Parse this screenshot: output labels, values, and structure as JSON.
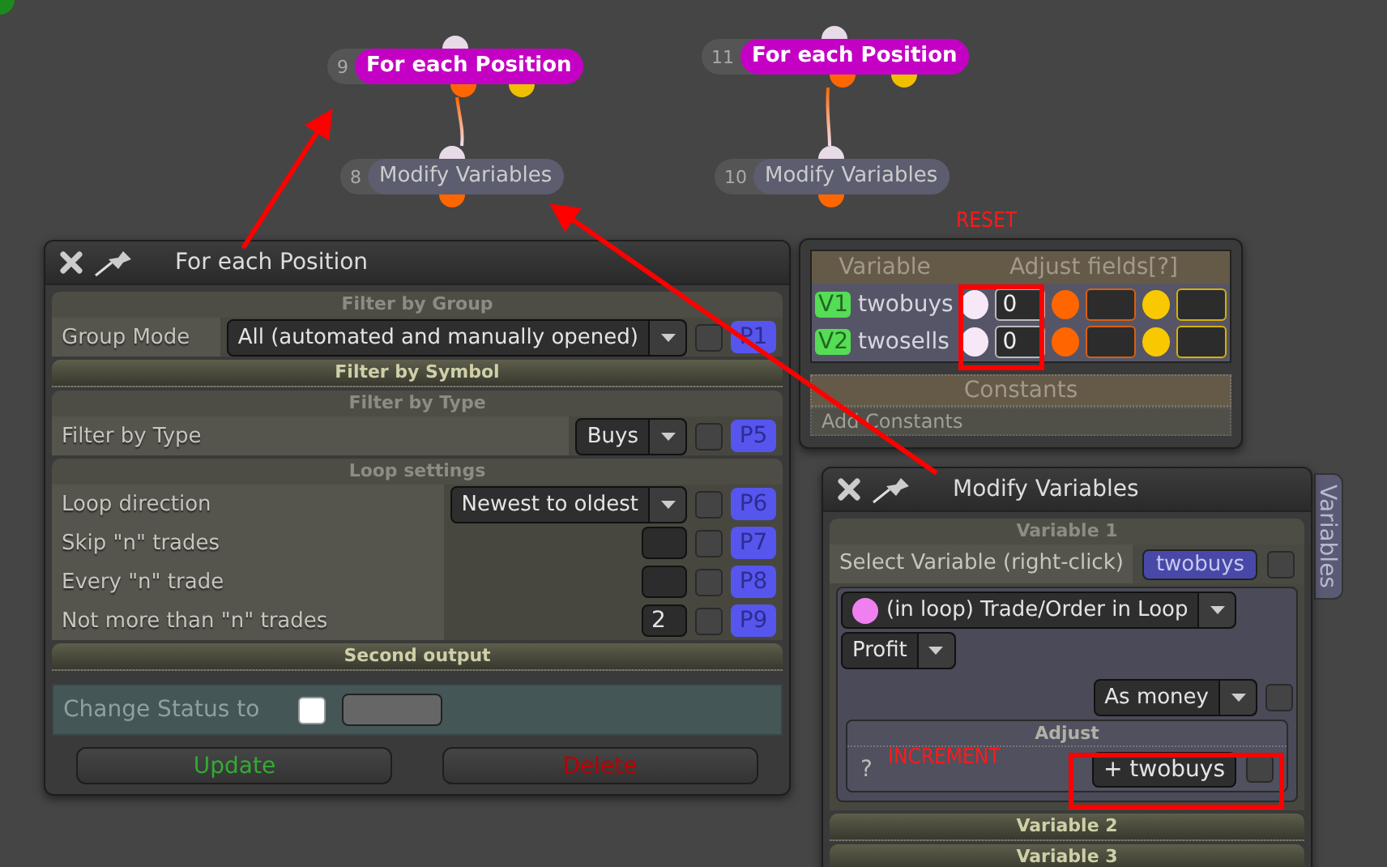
{
  "canvas_nodes": [
    {
      "number": "9",
      "label": "For each Position",
      "kind": "loop"
    },
    {
      "number": "8",
      "label": "Modify Variables",
      "kind": "action"
    },
    {
      "number": "11",
      "label": "For each Position",
      "kind": "loop"
    },
    {
      "number": "10",
      "label": "Modify Variables",
      "kind": "action"
    }
  ],
  "for_each_window": {
    "title": "For each Position",
    "sections": [
      {
        "title": "Filter by Group",
        "expanded": true,
        "rows": [
          {
            "label": "Group Mode",
            "kind": "dropdown",
            "value": "All (automated and manually opened)",
            "checked": false,
            "param": "P1"
          }
        ]
      },
      {
        "title": "Filter by Symbol",
        "expanded": false
      },
      {
        "title": "Filter by Type",
        "expanded": true,
        "rows": [
          {
            "label": "Filter by Type",
            "kind": "dropdown",
            "value": "Buys",
            "checked": false,
            "param": "P5"
          }
        ]
      },
      {
        "title": "Loop settings",
        "expanded": true,
        "rows": [
          {
            "label": "Loop direction",
            "kind": "dropdown",
            "value": "Newest to oldest",
            "checked": false,
            "param": "P6"
          },
          {
            "label": "Skip \"n\" trades",
            "kind": "number",
            "checked": false,
            "param": "P7"
          },
          {
            "label": "Every \"n\" trade",
            "kind": "number",
            "checked": false,
            "param": "P8"
          },
          {
            "label": "Not more than \"n\" trades",
            "kind": "number",
            "value": "2",
            "checked": false,
            "param": "P9"
          }
        ]
      },
      {
        "title": "Second output",
        "expanded": false
      }
    ],
    "status_row": {
      "label": "Change Status to",
      "checked": false
    },
    "buttons": [
      {
        "label": "Update",
        "kind": "confirm"
      },
      {
        "label": "Delete",
        "kind": "danger"
      }
    ]
  },
  "variables_window": {
    "columns": [
      "Variable",
      "Adjust fields[?]"
    ],
    "variables": [
      {
        "id": "V1",
        "name": "twobuys",
        "value": "0"
      },
      {
        "id": "V2",
        "name": "twosells",
        "value": "0"
      }
    ],
    "constants_title": "Constants",
    "add_constants": "Add Constants"
  },
  "modify_window": {
    "title": "Modify Variables",
    "side_tab": "Variables",
    "variable_sections": [
      {
        "title": "Variable 1",
        "expanded": true
      },
      {
        "title": "Variable 2",
        "expanded": false
      },
      {
        "title": "Variable 3",
        "expanded": false
      }
    ],
    "select_label": "Select Variable (right-click)",
    "selected_variable": "twobuys",
    "select_checked": false,
    "source": "(in loop) Trade/Order in Loop",
    "property": "Profit",
    "format": "As money",
    "format_checked": false,
    "adjust_title": "Adjust",
    "adjust_hint": "?",
    "adjust_button": "+ twobuys",
    "adjust_checked": false
  },
  "annotations": [
    {
      "kind": "label",
      "text": "RESET"
    },
    {
      "kind": "label",
      "text": "INCREMENT"
    }
  ]
}
